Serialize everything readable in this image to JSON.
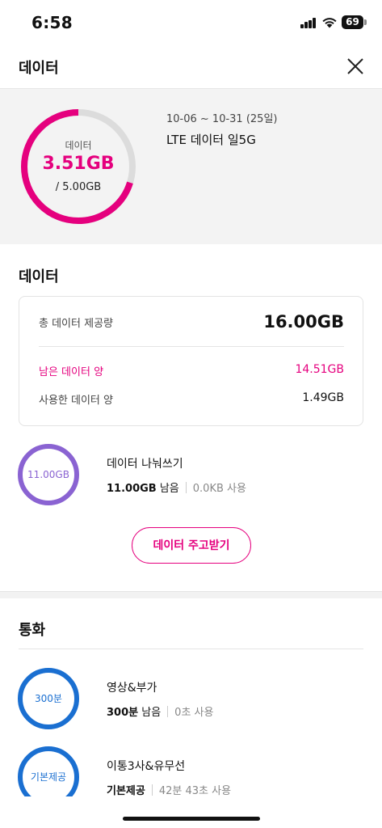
{
  "status_bar": {
    "time": "6:58",
    "battery": "69",
    "signal_icon": "cellular-signal-icon",
    "wifi_icon": "wifi-icon"
  },
  "header": {
    "title": "데이터",
    "close_icon": "close-icon"
  },
  "summary": {
    "ring_label": "데이터",
    "remaining": "3.51GB",
    "total": "/ 5.00GB",
    "period": "10-06 ~ 10-31 (25일)",
    "plan": "LTE 데이터 일5G",
    "ring_fraction": 0.702,
    "accent": "#e5007e"
  },
  "data_section": {
    "title": "데이터",
    "total_label": "총 데이터 제공량",
    "total_value": "16.00GB",
    "remaining_label": "남은 데이터 양",
    "remaining_value": "14.51GB",
    "used_label": "사용한 데이터 양",
    "used_value": "1.49GB"
  },
  "share": {
    "circle_text": "11.00GB",
    "title": "데이터 나눠쓰기",
    "amount": "11.00GB",
    "remain_word": "남음",
    "used": "0.0KB 사용",
    "color": "#8a63d2"
  },
  "gift_button": {
    "label": "데이터 주고받기"
  },
  "call_section": {
    "title": "통화",
    "items": [
      {
        "circle_text": "300분",
        "title": "영상&부가",
        "amount": "300분",
        "remain_word": "남음",
        "used": "0초 사용",
        "color": "#1a6fd1"
      },
      {
        "circle_text": "기본제공",
        "title": "이통3사&유무선",
        "amount": "기본제공",
        "used": "42분 43초 사용",
        "color": "#1a6fd1"
      }
    ]
  }
}
